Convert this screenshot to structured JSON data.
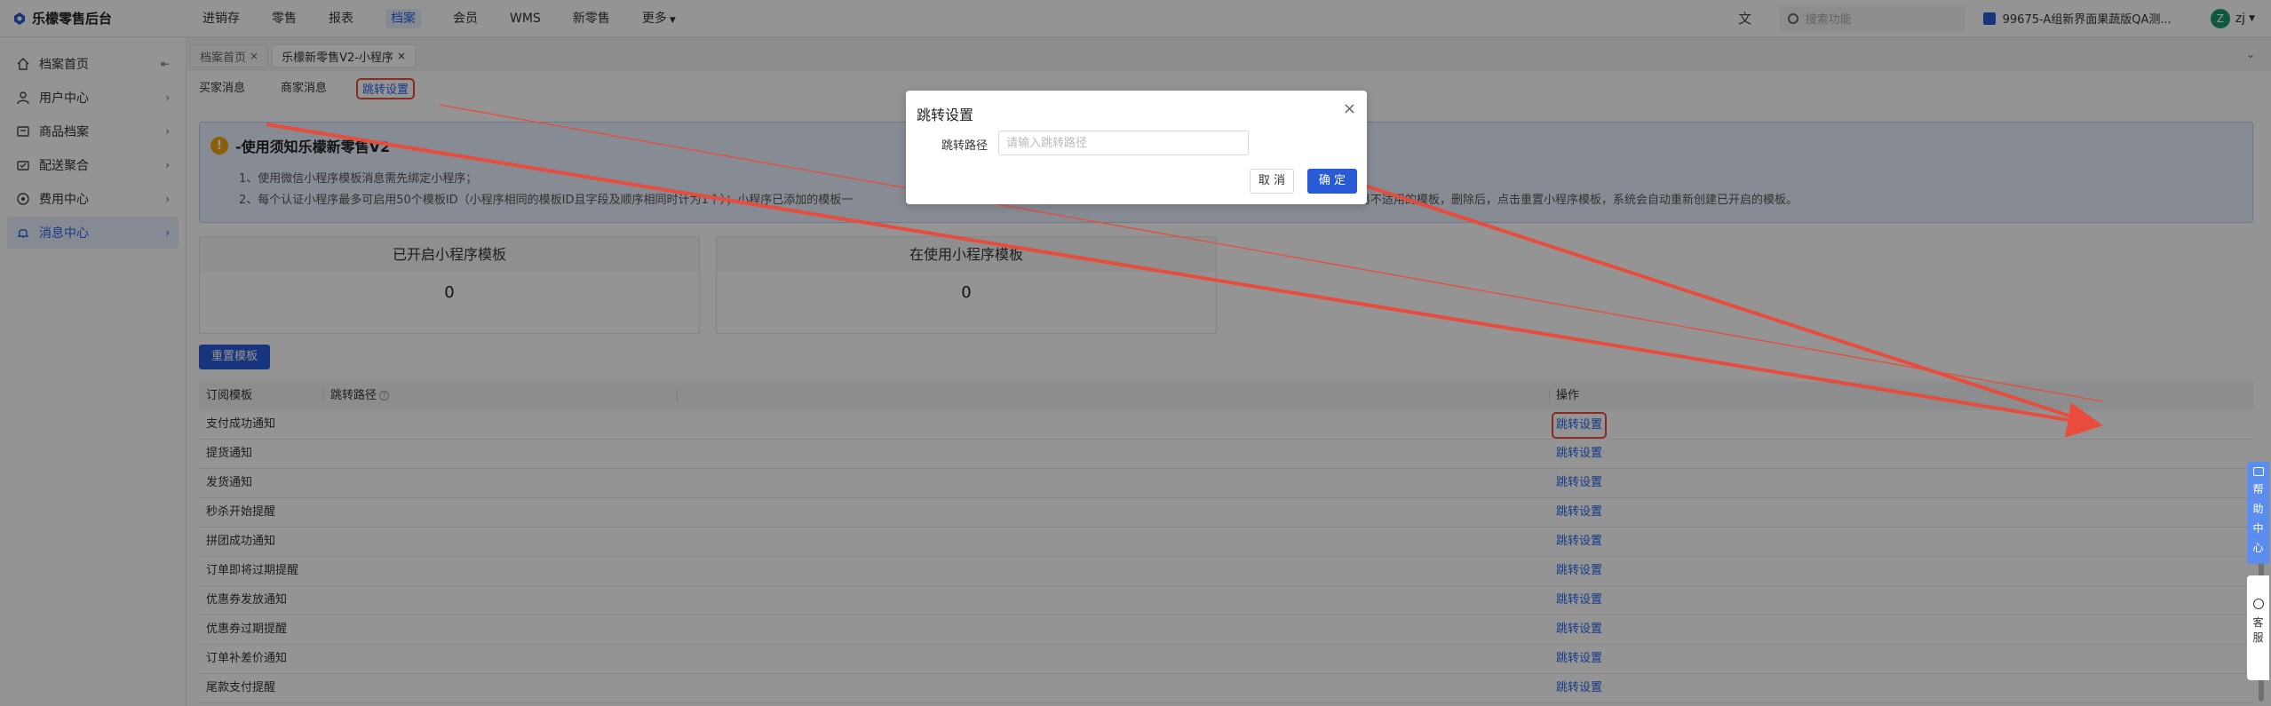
{
  "brand": {
    "name": "乐檬零售后台"
  },
  "topnav": [
    {
      "label": "进销存"
    },
    {
      "label": "零售"
    },
    {
      "label": "报表"
    },
    {
      "label": "档案"
    },
    {
      "label": "会员"
    },
    {
      "label": "WMS"
    },
    {
      "label": "新零售"
    },
    {
      "label": "更多"
    }
  ],
  "header": {
    "search_placeholder": "搜索功能",
    "store": "99675-A组新界面果蔬版QA测...",
    "avatar_letter": "Z",
    "user": "zj"
  },
  "sidebar": [
    {
      "label": "档案首页"
    },
    {
      "label": "用户中心"
    },
    {
      "label": "商品档案"
    },
    {
      "label": "配送聚合"
    },
    {
      "label": "费用中心"
    },
    {
      "label": "消息中心"
    }
  ],
  "pagetabs": [
    {
      "label": "档案首页"
    },
    {
      "label": "乐檬新零售V2-小程序"
    }
  ],
  "subtabs": [
    {
      "label": "买家消息"
    },
    {
      "label": "商家消息"
    },
    {
      "label": "跳转设置"
    }
  ],
  "notice": {
    "title": "-使用须知乐檬新零售V2",
    "line1": "1、使用微信小程序模板消息需先绑定小程序；",
    "line2": "2、每个认证小程序最多可启用50个模板ID（小程序相同的模板ID且字段及顺序相同时计为1个）；小程序已添加的模板一",
    "line2_tail": "另不适用的模板，删除后，点击重置小程序模板，系统会自动重新创建已开启的模板。"
  },
  "stats": [
    {
      "label": "已开启小程序模板",
      "value": "0"
    },
    {
      "label": "在使用小程序模板",
      "value": "0"
    }
  ],
  "reset_label": "重置模板",
  "table": {
    "col_template": "订阅模板",
    "col_path": "跳转路径",
    "col_op": "操作",
    "rows": [
      {
        "name": "支付成功通知",
        "op": "跳转设置"
      },
      {
        "name": "提货通知",
        "op": "跳转设置"
      },
      {
        "name": "发货通知",
        "op": "跳转设置"
      },
      {
        "name": "秒杀开始提醒",
        "op": "跳转设置"
      },
      {
        "name": "拼团成功通知",
        "op": "跳转设置"
      },
      {
        "name": "订单即将过期提醒",
        "op": "跳转设置"
      },
      {
        "name": "优惠券发放通知",
        "op": "跳转设置"
      },
      {
        "name": "优惠券过期提醒",
        "op": "跳转设置"
      },
      {
        "name": "订单补差价通知",
        "op": "跳转设置"
      },
      {
        "name": "尾款支付提醒",
        "op": "跳转设置"
      }
    ]
  },
  "dialog": {
    "title": "跳转设置",
    "label": "跳转路径",
    "placeholder": "请输入跳转路径",
    "value": "",
    "cancel": "取 消",
    "ok": "确 定"
  },
  "help": {
    "chars": [
      "帮",
      "助",
      "中",
      "心"
    ]
  },
  "service": {
    "chars": [
      "客",
      "服"
    ]
  },
  "colors": {
    "accent": "#2563eb",
    "primary_button": "#2a5bd7",
    "annotation": "#e74c3c",
    "warning": "#f2a20c"
  }
}
